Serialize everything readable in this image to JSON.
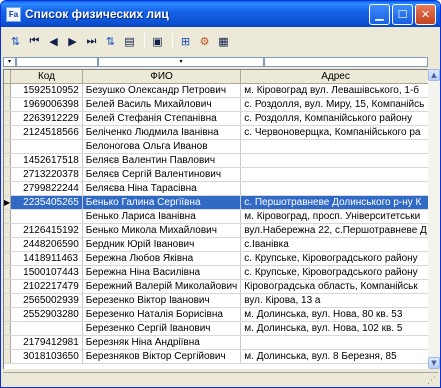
{
  "window": {
    "title": "Список физических лиц",
    "app_icon_text": "Fa",
    "minimize_glyph": "▁",
    "maximize_glyph": "☐",
    "close_glyph": "✕"
  },
  "toolbar": {
    "buttons": [
      {
        "icon": "sort-icon",
        "glyph": "⇅"
      },
      {
        "icon": "first-record-icon",
        "glyph": "⏮"
      },
      {
        "icon": "prior-record-icon",
        "glyph": "◀"
      },
      {
        "icon": "next-record-icon",
        "glyph": "▶"
      },
      {
        "icon": "last-record-icon",
        "glyph": "⏭"
      },
      {
        "icon": "sort-filter-icon",
        "glyph": "⇅"
      },
      {
        "icon": "export-icon",
        "glyph": "▤"
      },
      {
        "icon": "save-icon",
        "glyph": "▣"
      },
      {
        "icon": "edit-grid-icon",
        "glyph": "⊞"
      },
      {
        "icon": "settings-icon",
        "glyph": "⚙"
      },
      {
        "icon": "print-icon",
        "glyph": "▦"
      }
    ]
  },
  "filter": {
    "dropdown_glyph": "▾"
  },
  "grid": {
    "columns": [
      "Код",
      "ФИО",
      "Адрес"
    ],
    "row_indicator_glyph": "▶",
    "rows": [
      {
        "kod": "1592510952",
        "fio": "Безушко Олександр Петрович",
        "adres": "м. Кіровоград вул. Левашівського, 1-б"
      },
      {
        "kod": "1969006398",
        "fio": "Белей Василь Михайлович",
        "adres": "с. Роздолля, вул. Миру, 15, Компанійсь"
      },
      {
        "kod": "2263912229",
        "fio": "Белей Стефанія Степанівна",
        "adres": "с. Роздолля, Компанійського району"
      },
      {
        "kod": "2124518566",
        "fio": "Беліченко Людмила Іванівна",
        "adres": "с. Червоноверщка, Компанійського ра"
      },
      {
        "kod": "",
        "fio": "Белоногова Ольга Иванов",
        "adres": ""
      },
      {
        "kod": "1452617518",
        "fio": "Беляєв Валентин Павлович",
        "adres": ""
      },
      {
        "kod": "2713220378",
        "fio": "Беляєв Сергій Валентинович",
        "adres": ""
      },
      {
        "kod": "2799822244",
        "fio": "Беляєва Ніна Тарасівна",
        "adres": ""
      },
      {
        "kod": "2235405265",
        "fio": "Бенько Галина Сергіївна",
        "adres": "с. Першотравневе Долинського р-ну К"
      },
      {
        "kod": "",
        "fio": "Бенько Лариса Іванівна",
        "adres": "м. Кіровоград, просп. Університетськи"
      },
      {
        "kod": "2126415192",
        "fio": "Бенько Микола Михайлович",
        "adres": "вул.Набережна 22, с.Першотравневе Д"
      },
      {
        "kod": "2448206590",
        "fio": "Бердник Юрій Іванович",
        "adres": "с.Іванівка"
      },
      {
        "kod": "1418911463",
        "fio": "Бережна Любов Яківна",
        "adres": "с. Крупське, Кіровоградського району"
      },
      {
        "kod": "1500107443",
        "fio": "Бережна Ніна Василівна",
        "adres": "с. Крупське, Кіровоградського району"
      },
      {
        "kod": "2102217479",
        "fio": "Бережний Валерій Миколайович",
        "adres": "Кіровоградська область, Компанійськ"
      },
      {
        "kod": "2565002939",
        "fio": "Березенко Віктор Іванович",
        "adres": "вул. Кірова, 13 а"
      },
      {
        "kod": "2552903280",
        "fio": "Березенко Наталія Борисівна",
        "adres": "м. Долинська, вул. Нова, 80 кв. 53"
      },
      {
        "kod": "",
        "fio": "Березенко Сергій Іванович",
        "adres": "м. Долинська, вул. Нова, 102 кв. 5"
      },
      {
        "kod": "2179412981",
        "fio": "Березняк Ніна Андріївна",
        "adres": ""
      },
      {
        "kod": "3018103650",
        "fio": "Березняков Віктор Сергійович",
        "adres": "м. Долинська, вул. 8 Березня, 85"
      }
    ]
  },
  "scrollbar": {
    "up_glyph": "▲",
    "down_glyph": "▼"
  },
  "status": {
    "grip_glyph": "⋰"
  }
}
